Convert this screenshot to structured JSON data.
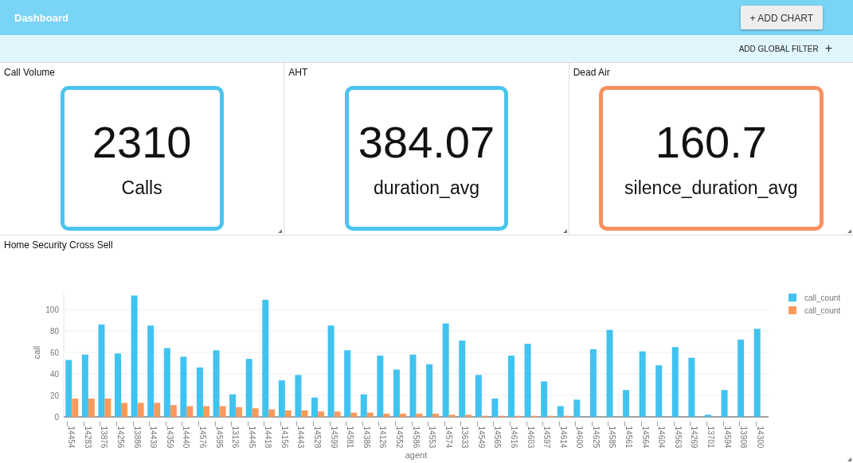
{
  "header": {
    "title": "Dashboard",
    "add_chart_button": "+ ADD CHART"
  },
  "filter_bar": {
    "label": "ADD GLOBAL FILTER",
    "icon": "+"
  },
  "stat_panels": [
    {
      "title": "Call Volume",
      "value": "2310",
      "label": "Calls",
      "color": "#4cc4ee"
    },
    {
      "title": "AHT",
      "value": "384.07",
      "label": "duration_avg",
      "color": "#4cc4ee"
    },
    {
      "title": "Dead Air",
      "value": "160.7",
      "label": "silence_duration_avg",
      "color": "#f59160"
    }
  ],
  "chart_panel": {
    "title": "Home Security Cross Sell",
    "chart_data": {
      "type": "bar",
      "xlabel": "agent",
      "ylabel": "call",
      "grid": true,
      "ylim": [
        0,
        115
      ],
      "yticks": [
        0,
        20,
        40,
        60,
        80,
        100
      ],
      "categories": [
        "_14454",
        "_14283",
        "_13876",
        "_14256",
        "_13886",
        "_14439",
        "_14359",
        "_14440",
        "_14576",
        "_14595",
        "_13126",
        "_14445",
        "_14418",
        "_14156",
        "_14443",
        "_14528",
        "_14599",
        "_14581",
        "_14386",
        "_14126",
        "_14552",
        "_14586",
        "_14553",
        "_14574",
        "_13633",
        "_14549",
        "_14565",
        "_14616",
        "_14603",
        "_14597",
        "_14614",
        "_14600",
        "_14625",
        "_14585",
        "_14561",
        "_14564",
        "_14604",
        "_14563",
        "_14269",
        "_13701",
        "_14594",
        "_13908",
        "_14300"
      ],
      "series": [
        {
          "name": "call_count",
          "color": "#41c3f0",
          "values": [
            53,
            58,
            86,
            59,
            113,
            85,
            64,
            56,
            46,
            62,
            21,
            54,
            109,
            34,
            39,
            18,
            85,
            62,
            21,
            57,
            44,
            58,
            49,
            87,
            71,
            39,
            17,
            57,
            68,
            33,
            10,
            16,
            63,
            81,
            25,
            61,
            48,
            65,
            55,
            2,
            25,
            72,
            82
          ]
        },
        {
          "name": "call_count",
          "color": "#f99a5c",
          "values": [
            17,
            17,
            17,
            13,
            13,
            13,
            11,
            10,
            10,
            10,
            9,
            8,
            7,
            6,
            6,
            5,
            5,
            4,
            4,
            3,
            3,
            3,
            3,
            2,
            2,
            1,
            1,
            1,
            1,
            1,
            1,
            0,
            0,
            0,
            0,
            0,
            0,
            0,
            0,
            0,
            0,
            0,
            0
          ]
        }
      ]
    }
  }
}
